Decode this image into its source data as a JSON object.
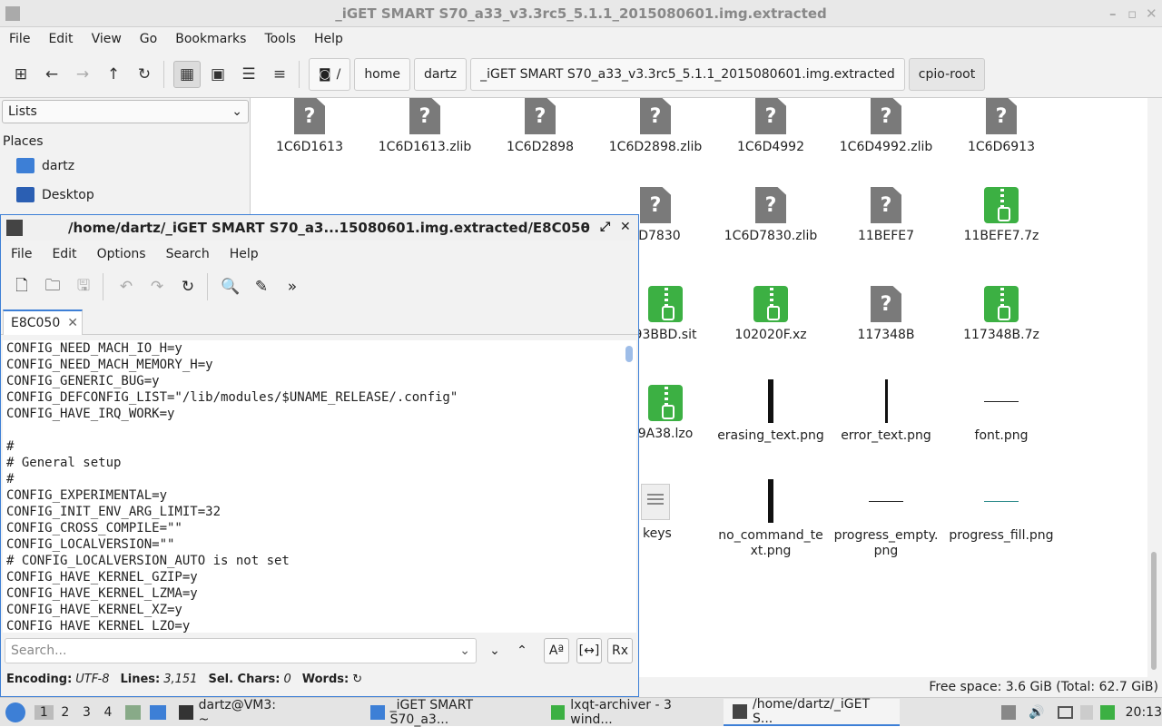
{
  "fm": {
    "title": "_iGET SMART S70_a33_v3.3rc5_5.1.1_2015080601.img.extracted",
    "menu": [
      "File",
      "Edit",
      "View",
      "Go",
      "Bookmarks",
      "Tools",
      "Help"
    ],
    "breadcrumbs": [
      "/",
      "home",
      "dartz",
      "_iGET SMART S70_a33_v3.3rc5_5.1.1_2015080601.img.extracted",
      "cpio-root"
    ],
    "sidebar": {
      "list_select": "Lists",
      "places_label": "Places",
      "places": [
        "dartz",
        "Desktop"
      ]
    },
    "files": [
      {
        "name": "1C6D1613",
        "type": "unknown"
      },
      {
        "name": "1C6D1613.zlib",
        "type": "unknown"
      },
      {
        "name": "1C6D2898",
        "type": "unknown"
      },
      {
        "name": "1C6D2898.zlib",
        "type": "unknown"
      },
      {
        "name": "1C6D4992",
        "type": "unknown"
      },
      {
        "name": "1C6D4992.zlib",
        "type": "unknown"
      },
      {
        "name": "1C6D6913",
        "type": "unknown"
      },
      {
        "name": "6D7830",
        "type": "unknown"
      },
      {
        "name": "1C6D7830.zlib",
        "type": "unknown"
      },
      {
        "name": "11BEFE7",
        "type": "unknown"
      },
      {
        "name": "11BEFE7.7z",
        "type": "archive"
      },
      {
        "name": "93BBD.sit",
        "type": "archive"
      },
      {
        "name": "102020F.xz",
        "type": "archive"
      },
      {
        "name": "117348B",
        "type": "unknown"
      },
      {
        "name": "117348B.7z",
        "type": "archive"
      },
      {
        "name": "9A38.lzo",
        "type": "archive"
      },
      {
        "name": "erasing_text.png",
        "type": "vbar"
      },
      {
        "name": "error_text.png",
        "type": "vbar-thin"
      },
      {
        "name": "font.png",
        "type": "hline"
      },
      {
        "name": "keys",
        "type": "text"
      },
      {
        "name": "no_command_text.png",
        "type": "vbar"
      },
      {
        "name": "progress_empty.png",
        "type": "hline"
      },
      {
        "name": "progress_fill.png",
        "type": "hline-teal"
      }
    ],
    "status": "Free space: 3.6 GiB (Total: 62.7 GiB)"
  },
  "editor": {
    "title": "/home/dartz/_iGET SMART S70_a3...15080601.img.extracted/E8C050",
    "menu": [
      "File",
      "Edit",
      "Options",
      "Search",
      "Help"
    ],
    "tab": "E8C050",
    "lines": [
      "CONFIG_NEED_MACH_IO_H=y",
      "CONFIG_NEED_MACH_MEMORY_H=y",
      "CONFIG_GENERIC_BUG=y",
      "CONFIG_DEFCONFIG_LIST=\"/lib/modules/$UNAME_RELEASE/.config\"",
      "CONFIG_HAVE_IRQ_WORK=y",
      "",
      "#",
      "# General setup",
      "#",
      "CONFIG_EXPERIMENTAL=y",
      "CONFIG_INIT_ENV_ARG_LIMIT=32",
      "CONFIG_CROSS_COMPILE=\"\"",
      "CONFIG_LOCALVERSION=\"\"",
      "# CONFIG_LOCALVERSION_AUTO is not set",
      "CONFIG_HAVE_KERNEL_GZIP=y",
      "CONFIG_HAVE_KERNEL_LZMA=y",
      "CONFIG_HAVE_KERNEL_XZ=y",
      "CONFIG_HAVE_KERNEL_LZO=y"
    ],
    "search_placeholder": "Search...",
    "status": {
      "encoding_label": "Encoding:",
      "encoding": "UTF-8",
      "lines_label": "Lines:",
      "lines": "3,151",
      "sel_label": "Sel. Chars:",
      "sel": "0",
      "words_label": "Words:"
    }
  },
  "taskbar": {
    "workspaces": [
      "1",
      "2",
      "3",
      "4"
    ],
    "tasks": [
      "dartz@VM3: ~",
      "_iGET SMART S70_a3...",
      "lxqt-archiver - 3 wind...",
      "/home/dartz/_iGET S..."
    ],
    "clock": "20:13"
  }
}
